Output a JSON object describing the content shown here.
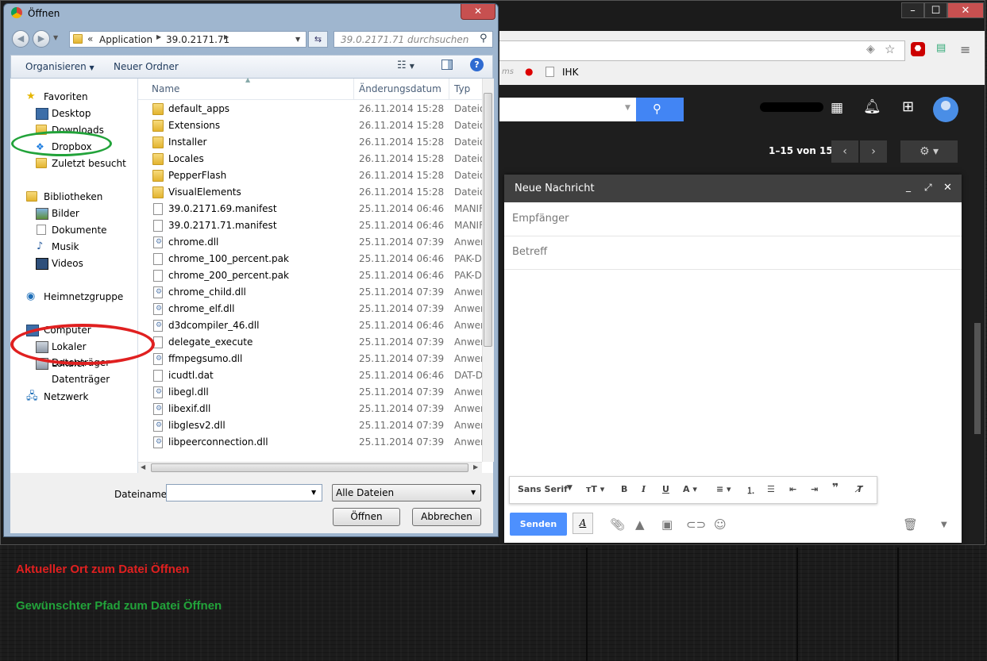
{
  "dialog": {
    "title": "Öffnen",
    "close": "✕",
    "address": {
      "prefix": "«",
      "segment1": "Application",
      "segment2": "39.0.2171.71"
    },
    "search_placeholder": "39.0.2171.71 durchsuchen",
    "toolbar": {
      "organize": "Organisieren",
      "new_folder": "Neuer Ordner"
    },
    "nav": {
      "favorites_label": "Favoriten",
      "favorites": [
        "Desktop",
        "Downloads",
        "Dropbox",
        "Zuletzt besucht"
      ],
      "libraries_label": "Bibliotheken",
      "libraries": [
        "Bilder",
        "Dokumente",
        "Musik",
        "Videos"
      ],
      "homegroup": "Heimnetzgruppe",
      "computer_label": "Computer",
      "drives": [
        "Lokaler Datenträger",
        "Lokaler Datenträger"
      ],
      "network": "Netzwerk"
    },
    "columns": {
      "name": "Name",
      "date": "Änderungsdatum",
      "type": "Typ"
    },
    "files": [
      {
        "name": "default_apps",
        "date": "26.11.2014 15:28",
        "type": "Dateio",
        "kind": "folder"
      },
      {
        "name": "Extensions",
        "date": "26.11.2014 15:28",
        "type": "Dateio",
        "kind": "folder"
      },
      {
        "name": "Installer",
        "date": "26.11.2014 15:28",
        "type": "Dateio",
        "kind": "folder"
      },
      {
        "name": "Locales",
        "date": "26.11.2014 15:28",
        "type": "Dateio",
        "kind": "folder"
      },
      {
        "name": "PepperFlash",
        "date": "26.11.2014 15:28",
        "type": "Dateio",
        "kind": "folder"
      },
      {
        "name": "VisualElements",
        "date": "26.11.2014 15:28",
        "type": "Dateio",
        "kind": "folder"
      },
      {
        "name": "39.0.2171.69.manifest",
        "date": "25.11.2014 06:46",
        "type": "MANIF",
        "kind": "file"
      },
      {
        "name": "39.0.2171.71.manifest",
        "date": "25.11.2014 06:46",
        "type": "MANIF",
        "kind": "file"
      },
      {
        "name": "chrome.dll",
        "date": "25.11.2014 07:39",
        "type": "Anwer",
        "kind": "dll"
      },
      {
        "name": "chrome_100_percent.pak",
        "date": "25.11.2014 06:46",
        "type": "PAK-D",
        "kind": "file"
      },
      {
        "name": "chrome_200_percent.pak",
        "date": "25.11.2014 06:46",
        "type": "PAK-D",
        "kind": "file"
      },
      {
        "name": "chrome_child.dll",
        "date": "25.11.2014 07:39",
        "type": "Anwer",
        "kind": "dll"
      },
      {
        "name": "chrome_elf.dll",
        "date": "25.11.2014 07:39",
        "type": "Anwer",
        "kind": "dll"
      },
      {
        "name": "d3dcompiler_46.dll",
        "date": "25.11.2014 06:46",
        "type": "Anwer",
        "kind": "dll"
      },
      {
        "name": "delegate_execute",
        "date": "25.11.2014 07:39",
        "type": "Anwer",
        "kind": "file"
      },
      {
        "name": "ffmpegsumo.dll",
        "date": "25.11.2014 07:39",
        "type": "Anwer",
        "kind": "dll"
      },
      {
        "name": "icudtl.dat",
        "date": "25.11.2014 06:46",
        "type": "DAT-D",
        "kind": "file"
      },
      {
        "name": "libegl.dll",
        "date": "25.11.2014 07:39",
        "type": "Anwer",
        "kind": "dll"
      },
      {
        "name": "libexif.dll",
        "date": "25.11.2014 07:39",
        "type": "Anwer",
        "kind": "dll"
      },
      {
        "name": "libglesv2.dll",
        "date": "25.11.2014 07:39",
        "type": "Anwer",
        "kind": "dll"
      },
      {
        "name": "libpeerconnection.dll",
        "date": "25.11.2014 07:39",
        "type": "Anwer",
        "kind": "dll"
      }
    ],
    "filename_label": "Dateiname:",
    "filename_value": "",
    "filter": "Alle Dateien",
    "open_button": "Öffnen",
    "cancel_button": "Abbrechen"
  },
  "chrome": {
    "bookmark": "IHK",
    "bookmark_partial": "ms"
  },
  "gmail": {
    "pager": "1–15 von 15",
    "compose": {
      "title": "Neue Nachricht",
      "to_placeholder": "Empfänger",
      "subject_placeholder": "Betreff",
      "font": "Sans Serif",
      "send": "Senden"
    }
  },
  "annotations": {
    "red": {
      "text": "Aktueller Ort zum Datei Öffnen",
      "color": "#e02020"
    },
    "green": {
      "text": "Gewünschter Pfad zum Datei Öffnen",
      "color": "#22a33a"
    }
  }
}
